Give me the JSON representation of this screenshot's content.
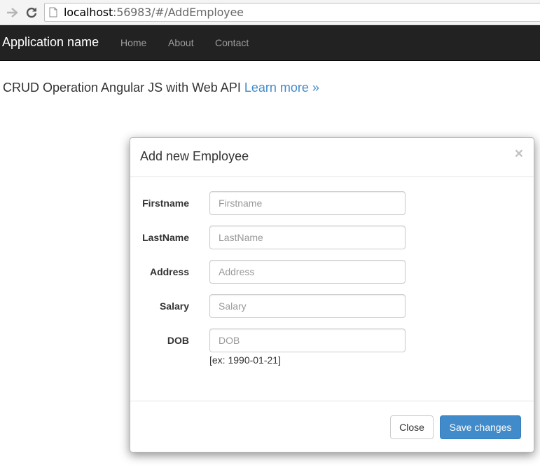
{
  "browser": {
    "url_host": "localhost",
    "url_rest": ":56983/#/AddEmployee"
  },
  "navbar": {
    "brand": "Application name",
    "links": [
      "Home",
      "About",
      "Contact"
    ]
  },
  "page": {
    "lead_text": "CRUD Operation Angular JS with Web API",
    "learn_more": "Learn more »"
  },
  "modal": {
    "title": "Add new Employee",
    "close_symbol": "×",
    "fields": [
      {
        "label": "Firstname",
        "placeholder": "Firstname",
        "value": ""
      },
      {
        "label": "LastName",
        "placeholder": "LastName",
        "value": ""
      },
      {
        "label": "Address",
        "placeholder": "Address",
        "value": ""
      },
      {
        "label": "Salary",
        "placeholder": "Salary",
        "value": ""
      },
      {
        "label": "DOB",
        "placeholder": "DOB",
        "value": ""
      }
    ],
    "dob_hint": "[ex: 1990-01-21]",
    "close_button": "Close",
    "save_button": "Save changes"
  },
  "colors": {
    "navbar_bg": "#222222",
    "link": "#428bca",
    "primary_button": "#428bca"
  },
  "icons": [
    "back-arrow-icon",
    "reload-icon",
    "page-icon"
  ]
}
